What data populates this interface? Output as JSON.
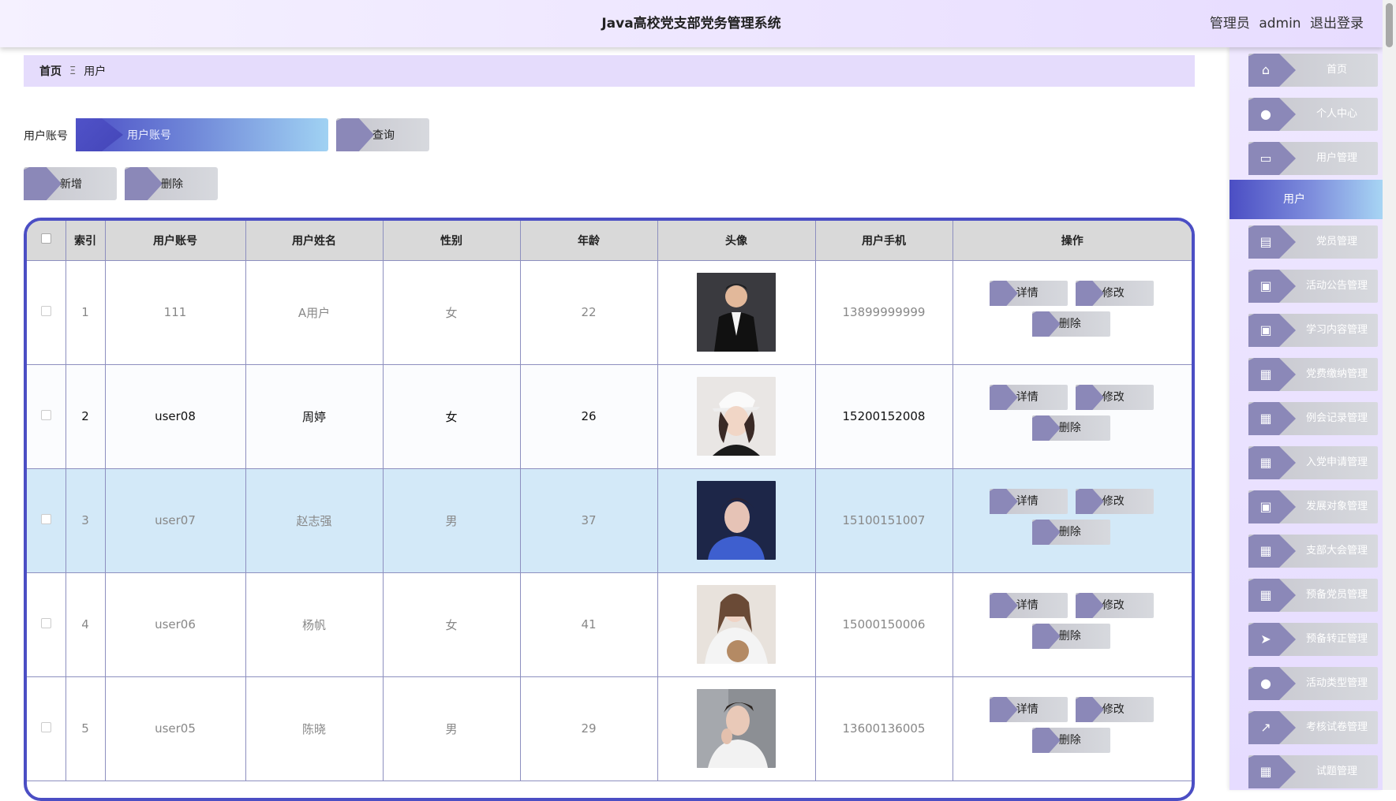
{
  "header": {
    "title": "Java高校党支部党务管理系统",
    "role": "管理员",
    "username": "admin",
    "logout": "退出登录"
  },
  "breadcrumb": {
    "home": "首页",
    "separator": "Ξ",
    "current": "用户"
  },
  "search": {
    "label": "用户账号",
    "placeholder": "用户账号",
    "button": "查询"
  },
  "actions": {
    "add": "新增",
    "delete": "删除"
  },
  "table": {
    "headers": [
      "索引",
      "用户账号",
      "用户姓名",
      "性别",
      "年龄",
      "头像",
      "用户手机",
      "操作"
    ],
    "row_actions": {
      "detail": "详情",
      "edit": "修改",
      "delete": "删除"
    },
    "rows": [
      {
        "index": "1",
        "account": "111",
        "name": "A用户",
        "gender": "女",
        "age": "22",
        "phone": "13899999999"
      },
      {
        "index": "2",
        "account": "user08",
        "name": "周婷",
        "gender": "女",
        "age": "26",
        "phone": "15200152008"
      },
      {
        "index": "3",
        "account": "user07",
        "name": "赵志强",
        "gender": "男",
        "age": "37",
        "phone": "15100151007"
      },
      {
        "index": "4",
        "account": "user06",
        "name": "杨帆",
        "gender": "女",
        "age": "41",
        "phone": "15000150006"
      },
      {
        "index": "5",
        "account": "user05",
        "name": "陈晓",
        "gender": "男",
        "age": "29",
        "phone": "13600136005"
      }
    ]
  },
  "sidebar": {
    "items": [
      {
        "label": "首页",
        "icon": "home-icon",
        "glyph": "⌂"
      },
      {
        "label": "个人中心",
        "icon": "person-icon",
        "glyph": "●"
      },
      {
        "label": "用户管理",
        "icon": "monitor-icon",
        "glyph": "▭"
      },
      {
        "label": "党员管理",
        "icon": "book-icon",
        "glyph": "▤"
      },
      {
        "label": "活动公告管理",
        "icon": "clipboard-x-icon",
        "glyph": "▣"
      },
      {
        "label": "学习内容管理",
        "icon": "clipboard-icon",
        "glyph": "▣"
      },
      {
        "label": "党费缴纳管理",
        "icon": "grid-icon",
        "glyph": "▦"
      },
      {
        "label": "例会记录管理",
        "icon": "grid-icon",
        "glyph": "▦"
      },
      {
        "label": "入党申请管理",
        "icon": "grid-icon",
        "glyph": "▦"
      },
      {
        "label": "发展对象管理",
        "icon": "clipboard-check-icon",
        "glyph": "▣"
      },
      {
        "label": "支部大会管理",
        "icon": "grid-icon",
        "glyph": "▦"
      },
      {
        "label": "预备党员管理",
        "icon": "grid-icon",
        "glyph": "▦"
      },
      {
        "label": "预备转正管理",
        "icon": "send-icon",
        "glyph": "➤"
      },
      {
        "label": "活动类型管理",
        "icon": "person-icon",
        "glyph": "●"
      },
      {
        "label": "考核试卷管理",
        "icon": "chart-icon",
        "glyph": "↗"
      },
      {
        "label": "试题管理",
        "icon": "grid-icon",
        "glyph": "▦"
      }
    ],
    "active": "用户"
  },
  "colors": {
    "accent": "#4b4ec4",
    "highlight_row": "#d3e9f8",
    "button_notch": "#8b88b8"
  }
}
